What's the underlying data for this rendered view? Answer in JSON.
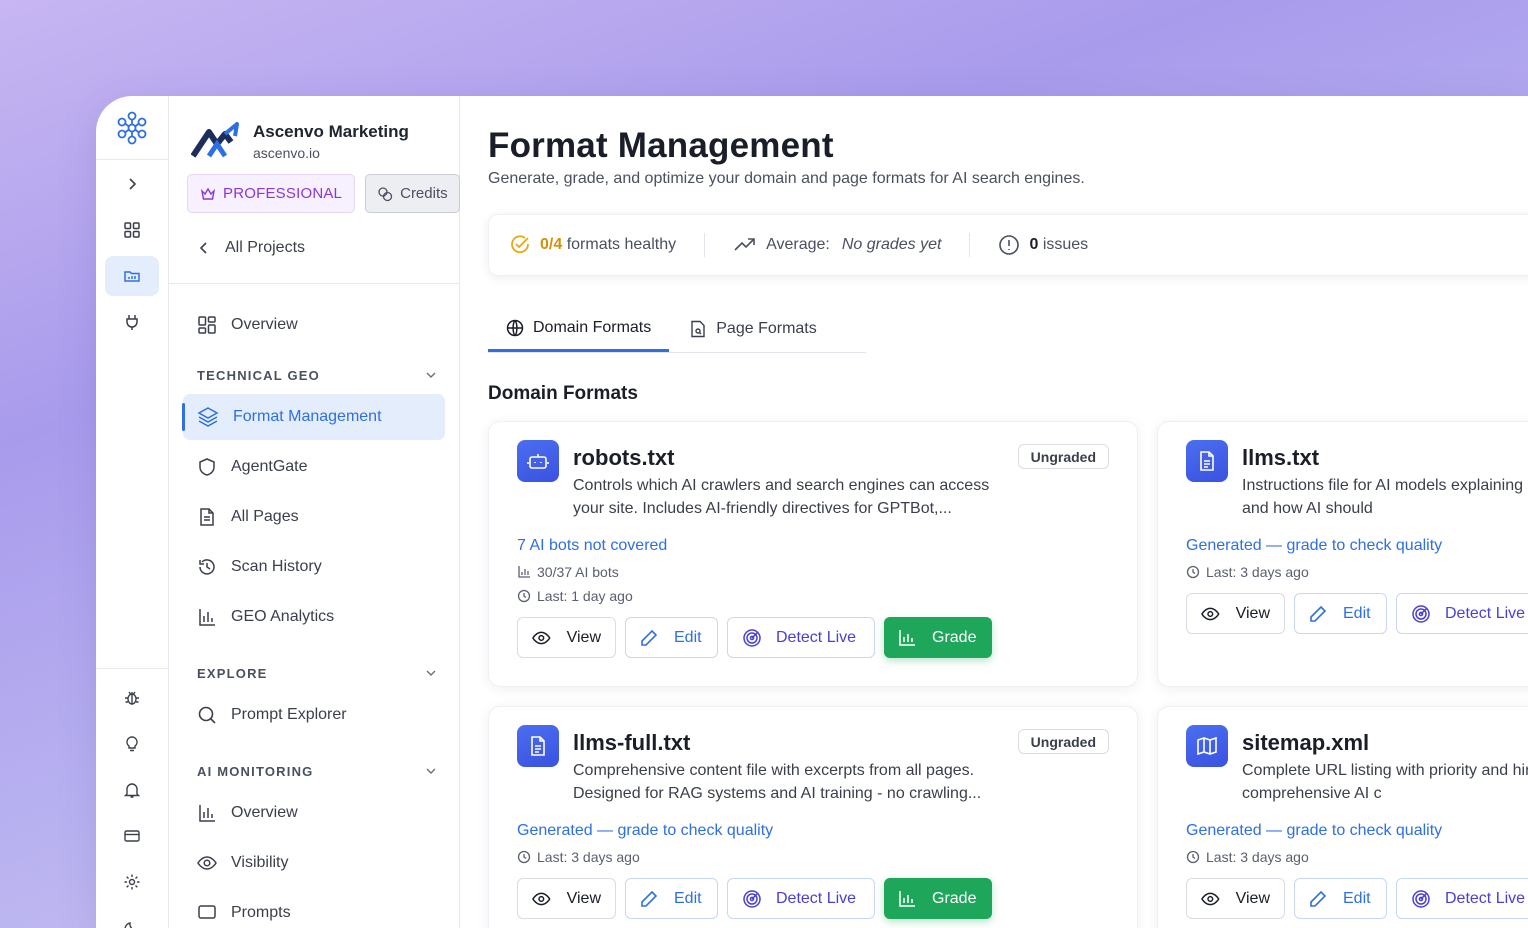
{
  "org": {
    "name": "Ascenvo Marketing",
    "domain": "ascenvo.io"
  },
  "badges": {
    "plan": "PROFESSIONAL",
    "credits": "Credits"
  },
  "nav": {
    "back": "All Projects",
    "overview": "Overview",
    "section_technical": "TECHNICAL GEO",
    "technical_items": [
      "Format Management",
      "AgentGate",
      "All Pages",
      "Scan History",
      "GEO Analytics"
    ],
    "section_explore": "EXPLORE",
    "explore_items": [
      "Prompt Explorer"
    ],
    "section_monitoring": "AI MONITORING",
    "monitoring_items": [
      "Overview",
      "Visibility",
      "Prompts"
    ]
  },
  "page": {
    "title": "Format Management",
    "subtitle": "Generate, grade, and optimize your domain and page formats for AI search engines."
  },
  "stats": {
    "healthy_count": "0/4",
    "healthy_label": "formats healthy",
    "average_label": "Average:",
    "average_value": "No grades yet",
    "issues_count": "0",
    "issues_label": "issues"
  },
  "tabs": [
    "Domain Formats",
    "Page Formats"
  ],
  "section_title": "Domain Formats",
  "buttons": {
    "view": "View",
    "edit": "Edit",
    "detect": "Detect Live",
    "grade": "Grade"
  },
  "cards": [
    {
      "title": "robots.txt",
      "desc": "Controls which AI crawlers and search engines can access your site. Includes AI-friendly directives for GPTBot,...",
      "badge": "Ungraded",
      "link": "7 AI bots not covered",
      "meta1": "30/37 AI bots",
      "meta2": "Last: 1 day ago",
      "icon": "robot-icon"
    },
    {
      "title": "llms.txt",
      "desc": "Instructions file for AI models explaining purpose, key content, and how AI should",
      "link": "Generated — grade to check quality",
      "meta2": "Last: 3 days ago",
      "icon": "document-icon"
    },
    {
      "title": "llms-full.txt",
      "desc": "Comprehensive content file with excerpts from all pages. Designed for RAG systems and AI training - no crawling...",
      "badge": "Ungraded",
      "link": "Generated — grade to check quality",
      "meta2": "Last: 3 days ago",
      "icon": "document-icon"
    },
    {
      "title": "sitemap.xml",
      "desc": "Complete URL listing with priority and hints. Essential for comprehensive AI c",
      "link": "Generated — grade to check quality",
      "meta2": "Last: 3 days ago",
      "icon": "map-icon"
    }
  ],
  "colors": {
    "accent": "#2f6fe4",
    "grade": "#1ea65a",
    "pro": "#8b36d8",
    "warn": "#e6a817"
  }
}
